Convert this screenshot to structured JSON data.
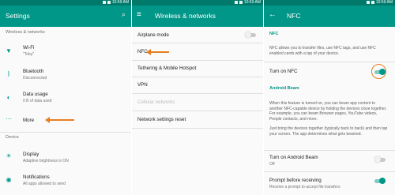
{
  "status_time": "10:59 AM",
  "colors": {
    "primary": "#009688",
    "primary_dark": "#00796b",
    "accent_annotation": "#e67e22"
  },
  "settings": {
    "title": "Settings",
    "search_icon": "search-icon",
    "section_wireless": "Wireless & networks",
    "wifi": {
      "title": "Wi-Fi",
      "subtitle": "\"Toby\""
    },
    "bluetooth": {
      "title": "Bluetooth",
      "subtitle": "Disconnected"
    },
    "data_usage": {
      "title": "Data usage",
      "subtitle": "0 B of data used"
    },
    "more": {
      "title": "More"
    },
    "section_device": "Device",
    "display": {
      "title": "Display",
      "subtitle": "Adaptive brightness is ON"
    },
    "notifications": {
      "title": "Notifications",
      "subtitle": "All apps allowed to send"
    }
  },
  "wireless": {
    "title": "Wireless & networks",
    "items": [
      "Airplane mode",
      "NFC",
      "Tethering & Mobile Hotspot",
      "VPN",
      "Cellular networks",
      "Network settings reset"
    ]
  },
  "nfc": {
    "title": "NFC",
    "section": "NFC",
    "description": "NFC allows you to transfer files, use NFC tags, and use NFC enabled cards with a tap of your device.",
    "turn_on_label": "Turn on NFC",
    "turn_on_state": true,
    "android_beam_section": "Android Beam",
    "beam_description_1": "When this feature is turned on, you can beam app content to another NFC-capable device by holding the devices close together. For example, you can beam Browser pages, YouTube videos, People contacts, and more.",
    "beam_description_2": "Just bring the devices together (typically back to back) and then tap your screen. The app determines what gets beamed.",
    "turn_on_beam": {
      "title": "Turn on Android Beam",
      "subtitle": "Off",
      "state": false
    },
    "prompt": {
      "title": "Prompt before receiving",
      "subtitle": "Receive a prompt to accept file transfers",
      "state": true
    }
  }
}
